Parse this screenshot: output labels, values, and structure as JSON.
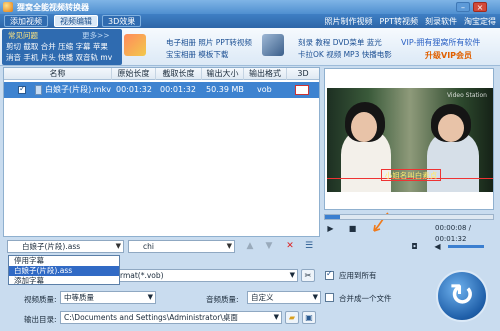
{
  "window": {
    "title": "狸窝全能视频转换器"
  },
  "menubar": {
    "tabs": [
      "添加视频",
      "视频编辑",
      "3D效果"
    ],
    "links": [
      "照片制作视频",
      "PPT转视频",
      "刻录软件",
      "淘宝定得"
    ]
  },
  "faq": {
    "title": "常见问题",
    "more": "更多>>",
    "row1": "剪切 截取 合并 压缩 字幕 苹果",
    "row2": "消音 手机 片头 快播 双音轨 mv"
  },
  "ads": {
    "a1_line1": "电子相册 照片 PPT转视频",
    "a1_line2": "宝宝相册 模板下载",
    "a2_line1": "刻录 教程 DVD菜单 蓝光",
    "a2_line2": "卡拉OK 视频 MP3 快播电影",
    "vip1": "VIP-拥有狸窝所有软件",
    "vip2": "升级VIP会员"
  },
  "table": {
    "columns": [
      "名称",
      "原始长度",
      "截取长度",
      "输出大小",
      "输出格式",
      "3D"
    ],
    "rows": [
      {
        "name": "白娘子(片段).mkv",
        "original": "00:01:32",
        "cut": "00:01:32",
        "size": "50.39 MB",
        "format": "vob"
      }
    ]
  },
  "player": {
    "watermark": "Video Station",
    "subtitle": "小姐名叫白素貞",
    "time": "00:00:08 / 00:01:32",
    "progress": 0.09
  },
  "subtitle_select": {
    "value": "白娘子(片段).ass",
    "options": [
      "停用字幕",
      "白娘子(片段).ass",
      "添加字幕"
    ],
    "selected_index": 1
  },
  "audio_select": {
    "value": "chi"
  },
  "settings": {
    "format_value": "rmat(*.vob)",
    "apply_all": "应用到所有",
    "video_quality_label": "视频质量:",
    "video_quality": "中等质量",
    "audio_quality_label": "音频质量:",
    "audio_quality": "自定义",
    "merge": "合并成一个文件",
    "output_label": "输出目录:",
    "output_path": "C:\\Documents and Settings\\Administrator\\桌面"
  },
  "colors": {
    "accent": "#2f6bb0",
    "selection": "#3e83d0",
    "brand": "#e06000"
  }
}
